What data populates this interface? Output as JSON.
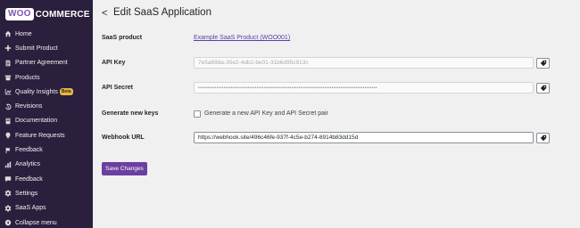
{
  "brand": {
    "woo": "WOO",
    "commerce": "COMMERCE"
  },
  "sidebar": {
    "items": [
      {
        "label": "Home",
        "icon": "home-icon"
      },
      {
        "label": "Submit Product",
        "icon": "plus-icon"
      },
      {
        "label": "Partner Agreement",
        "icon": "document-icon"
      },
      {
        "label": "Products",
        "icon": "box-icon"
      },
      {
        "label": "Quality Insights",
        "icon": "chart-icon",
        "badge": "Beta"
      },
      {
        "label": "Revisions",
        "icon": "revisions-icon"
      },
      {
        "label": "Documentation",
        "icon": "book-icon"
      },
      {
        "label": "Feature Requests",
        "icon": "lightbulb-icon"
      },
      {
        "label": "Feedback",
        "icon": "flag-icon"
      },
      {
        "label": "Analytics",
        "icon": "bar-chart-icon"
      },
      {
        "label": "Feedback",
        "icon": "comment-icon"
      },
      {
        "label": "Settings",
        "icon": "gear-icon"
      },
      {
        "label": "SaaS Apps",
        "icon": "gear-icon"
      },
      {
        "label": "Collapse menu",
        "icon": "collapse-icon"
      }
    ]
  },
  "header": {
    "back": "<",
    "title": "Edit SaaS Application"
  },
  "form": {
    "saas_product_label": "SaaS product",
    "saas_product_value": "Example SaaS Product (WOO001)",
    "api_key_label": "API Key",
    "api_key_value": "7e5a69da-35e2-4db2-be01-31b6d95c913c",
    "api_secret_label": "API Secret",
    "api_secret_value": "••••••••••••••••••••••••••••••••••••••••••••••••••••••••••••••••••••••••••••••••••••••••••••••••••",
    "generate_label": "Generate new keys",
    "generate_checkbox_label": "Generate a new API Key and API Secret pair",
    "webhook_label": "Webhook URL",
    "webhook_value": "https://webhook.site/496c46fe-937f-4c5e-b274-8914b83dd15d",
    "save_label": "Save Changes"
  },
  "colors": {
    "sidebar_bg": "#2a1f3d",
    "accent": "#6b3fa0",
    "link": "#5b3fa3",
    "badge": "#e9b841"
  }
}
